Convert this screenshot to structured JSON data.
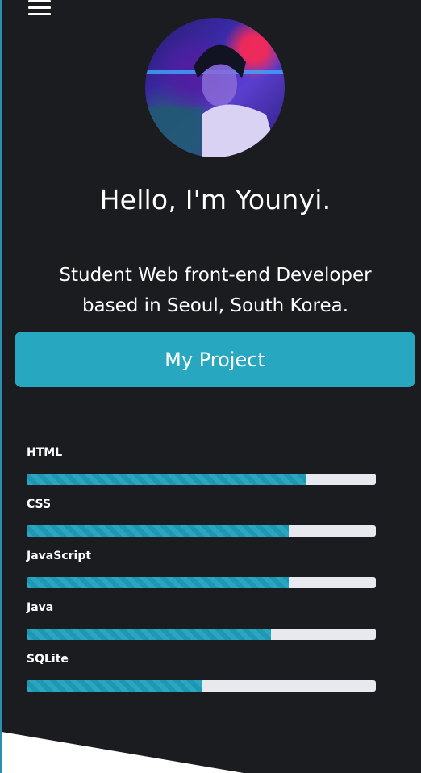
{
  "header": {
    "menu_icon": "hamburger-menu-icon"
  },
  "profile": {
    "avatar_alt": "profile photo",
    "greeting": "Hello, I'm Younyi.",
    "description": "Student Web front-end Developer based in Seoul, South Korea."
  },
  "actions": {
    "project_button": "My Project"
  },
  "skills": [
    {
      "label": "HTML",
      "level": 0.8
    },
    {
      "label": "CSS",
      "level": 0.75
    },
    {
      "label": "JavaScript",
      "level": 0.75
    },
    {
      "label": "Java",
      "level": 0.7
    },
    {
      "label": "SQLite",
      "level": 0.5
    }
  ],
  "colors": {
    "background": "#1b1c20",
    "accent": "#27a8c0",
    "track": "#e8e9ee"
  }
}
